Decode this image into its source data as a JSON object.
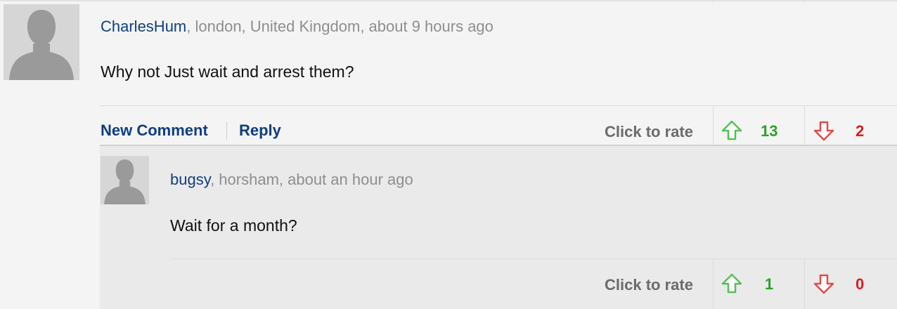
{
  "comment": {
    "username": "CharlesHum",
    "meta": ", london, United Kingdom, about 9 hours ago",
    "text": "Why not Just wait and arrest them?",
    "actions": {
      "new_comment": "New Comment",
      "reply": "Reply"
    },
    "rate_label": "Click to rate",
    "up_count": "13",
    "down_count": "2"
  },
  "reply": {
    "username": "bugsy",
    "meta": ", horsham, about an hour ago",
    "text": "Wait for a month?",
    "rate_label": "Click to rate",
    "up_count": "1",
    "down_count": "0"
  },
  "colors": {
    "link": "#0f3e82",
    "up": "#2aa12a",
    "down": "#e01b1b",
    "up_arrow": "#55c055",
    "down_arrow": "#e64a4a"
  },
  "icons": {
    "avatar": "default-user-silhouette-icon",
    "up": "arrow-up-outline-icon",
    "down": "arrow-down-outline-icon"
  }
}
